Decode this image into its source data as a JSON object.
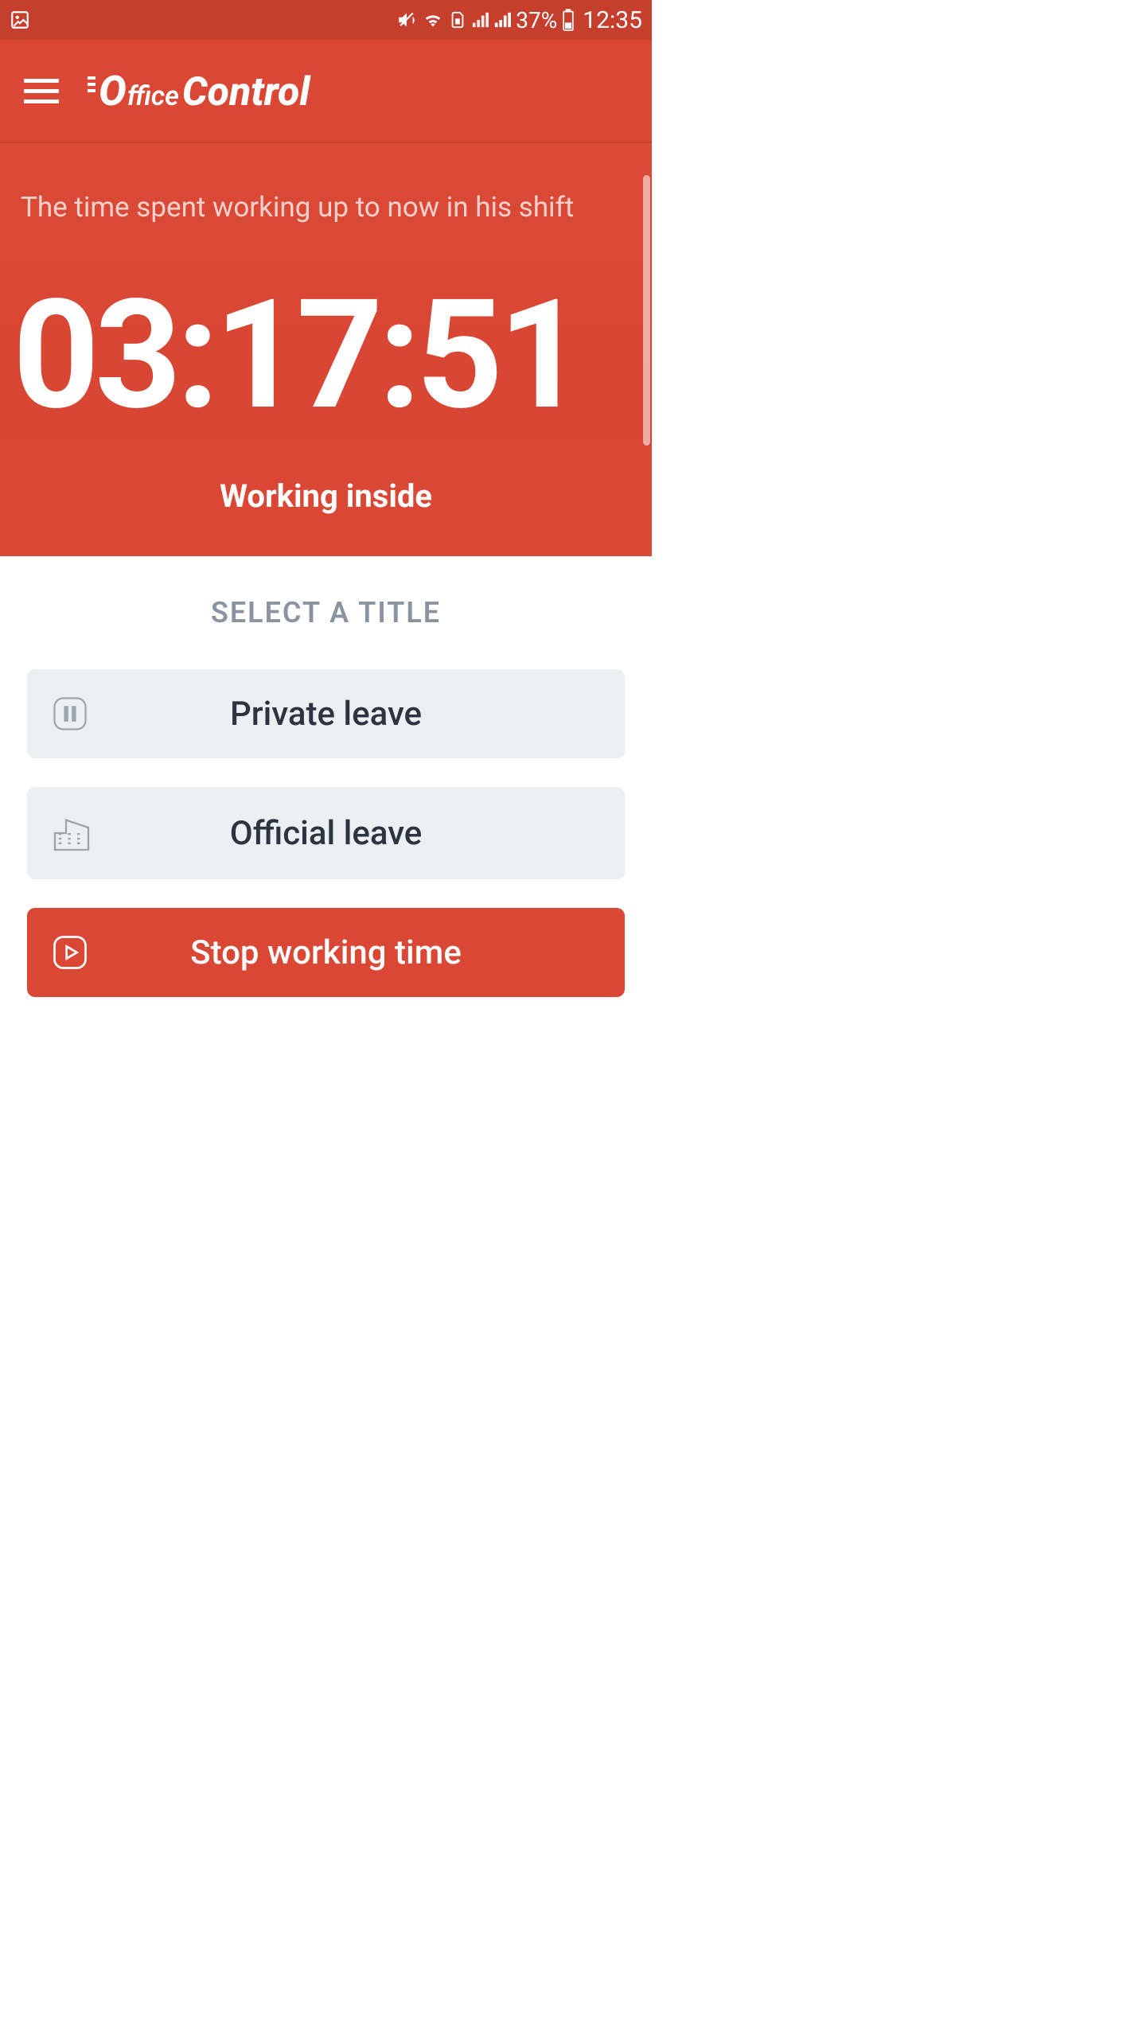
{
  "status": {
    "battery_pct": "37%",
    "clock": "12:35"
  },
  "brand": {
    "o": "O",
    "ffice": "ffice",
    "control": "Control"
  },
  "hero": {
    "subtitle": "The time spent working up to now in his shift",
    "timer": "03:17:51",
    "status": "Working inside"
  },
  "panel": {
    "heading": "SELECT A TITLE",
    "options": [
      {
        "label": "Private leave"
      },
      {
        "label": "Official leave"
      },
      {
        "label": "Stop working time"
      }
    ]
  }
}
